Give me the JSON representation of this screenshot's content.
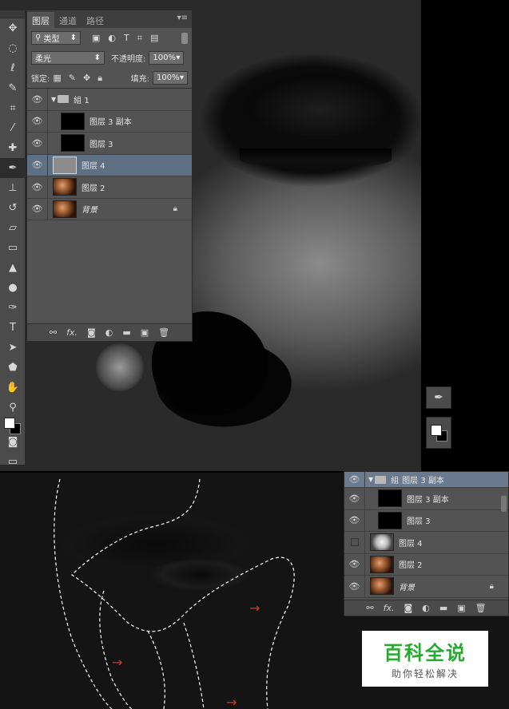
{
  "layers_panel": {
    "tabs": [
      "图层",
      "通道",
      "路径"
    ],
    "filter_label": "类型",
    "blend_mode": "柔光",
    "opacity_label": "不透明度:",
    "opacity_value": "100%",
    "lock_label": "锁定:",
    "fill_label": "填充:",
    "fill_value": "100%",
    "layers": [
      {
        "name": "組 1"
      },
      {
        "name": "图层 3 副本"
      },
      {
        "name": "图层 3"
      },
      {
        "name": "图层 4"
      },
      {
        "name": "图层 2"
      },
      {
        "name": "背景"
      }
    ],
    "footer_icons": [
      "link-icon",
      "fx-icon",
      "mask-icon",
      "adjustment-icon",
      "folder-icon",
      "new-layer-icon",
      "trash-icon"
    ]
  },
  "layers_panel_2": {
    "layers": [
      {
        "name": "組"
      },
      {
        "name": "图层 3 副本"
      },
      {
        "name": "图层 3"
      },
      {
        "name": "图层 4"
      },
      {
        "name": "图层 2"
      },
      {
        "name": "背景"
      }
    ],
    "overlay_text": "图层 3 副本"
  },
  "tools": [
    "move-tool",
    "marquee-tool",
    "lasso-tool",
    "quick-select-tool",
    "crop-tool",
    "eyedropper-tool",
    "healing-tool",
    "brush-tool",
    "stamp-tool",
    "history-brush-tool",
    "eraser-tool",
    "gradient-tool",
    "blur-tool",
    "dodge-tool",
    "pen-tool",
    "type-tool",
    "path-select-tool",
    "shape-tool",
    "hand-tool",
    "zoom-tool"
  ],
  "watermark": {
    "title": "百科全说",
    "subtitle": "助你轻松解决"
  },
  "colors": {
    "panel_bg": "#535353",
    "selected_row": "#5f6f84",
    "watermark_green": "#27a830",
    "arrow_red": "#d9332a"
  }
}
